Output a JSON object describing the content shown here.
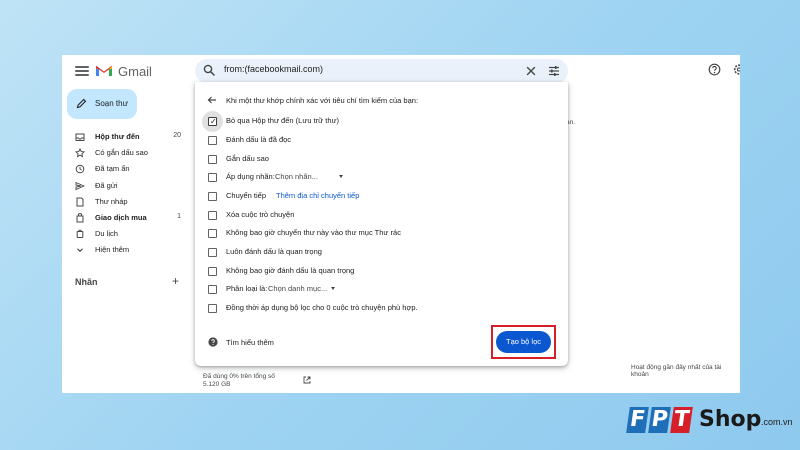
{
  "header": {
    "app_name": "Gmail",
    "search_query": "from:(facebookmail.com)",
    "icons": [
      "menu-icon",
      "gmail-logo-icon",
      "search-icon",
      "clear-icon",
      "tune-icon",
      "help-icon",
      "gear-icon"
    ]
  },
  "sidebar": {
    "compose_label": "Soạn thư",
    "items": [
      {
        "label": "Hộp thư đến",
        "count": "20",
        "bold": true,
        "icon": "inbox-icon"
      },
      {
        "label": "Có gắn dấu sao",
        "count": "",
        "bold": false,
        "icon": "star-icon"
      },
      {
        "label": "Đã tạm ẩn",
        "count": "",
        "bold": false,
        "icon": "clock-icon"
      },
      {
        "label": "Đã gửi",
        "count": "",
        "bold": false,
        "icon": "send-icon"
      },
      {
        "label": "Thư nháp",
        "count": "",
        "bold": false,
        "icon": "draft-icon"
      },
      {
        "label": "Giao dịch mua",
        "count": "1",
        "bold": true,
        "icon": "tag-icon"
      },
      {
        "label": "Du lịch",
        "count": "",
        "bold": false,
        "icon": "luggage-icon"
      },
      {
        "label": "Hiện thêm",
        "count": "",
        "bold": false,
        "icon": "chevron-down-icon"
      }
    ],
    "labels_title": "Nhãn",
    "labels_add": "+"
  },
  "background": {
    "fragment_right": "ạn.",
    "storage_line1": "Đã dùng 0% trên tổng số",
    "storage_line2": "5.120 GB",
    "activity": "Hoạt động gần đây nhất của tài khoản"
  },
  "dialog": {
    "title": "Khi một thư khớp chính xác với tiêu chí tìm kiếm của bạn:",
    "options": [
      {
        "label": "Bỏ qua Hộp thư đến (Lưu trữ thư)",
        "checked": true
      },
      {
        "label": "Đánh dấu là đã đọc",
        "checked": false
      },
      {
        "label": "Gắn dấu sao",
        "checked": false
      },
      {
        "label": "Áp dụng nhãn:",
        "checked": false,
        "select": "Chọn nhãn..."
      },
      {
        "label": "Chuyển tiếp",
        "checked": false,
        "link": "Thêm địa chỉ chuyển tiếp"
      },
      {
        "label": "Xóa cuộc trò chuyện",
        "checked": false
      },
      {
        "label": "Không bao giờ chuyển thư này vào thư mục Thư rác",
        "checked": false
      },
      {
        "label": "Luôn đánh dấu là quan trọng",
        "checked": false
      },
      {
        "label": "Không bao giờ đánh dấu là quan trọng",
        "checked": false
      },
      {
        "label": "Phân loại là:",
        "checked": false,
        "select": "Chọn danh mục..."
      },
      {
        "label": "Đồng thời áp dụng bộ lọc cho 0 cuộc trò chuyện phù hợp.",
        "checked": false
      }
    ],
    "learn_more": "Tìm hiểu thêm",
    "create_filter": "Tạo bộ lọc",
    "highlight_color": "#d61f26",
    "primary_color": "#0b57d0"
  },
  "watermark": {
    "letters": [
      "F",
      "P",
      "T"
    ],
    "shop": "Shop",
    "domain": ".com.vn",
    "colors": [
      "#1f6fb8",
      "#1f6fb8",
      "#d61f26"
    ]
  }
}
